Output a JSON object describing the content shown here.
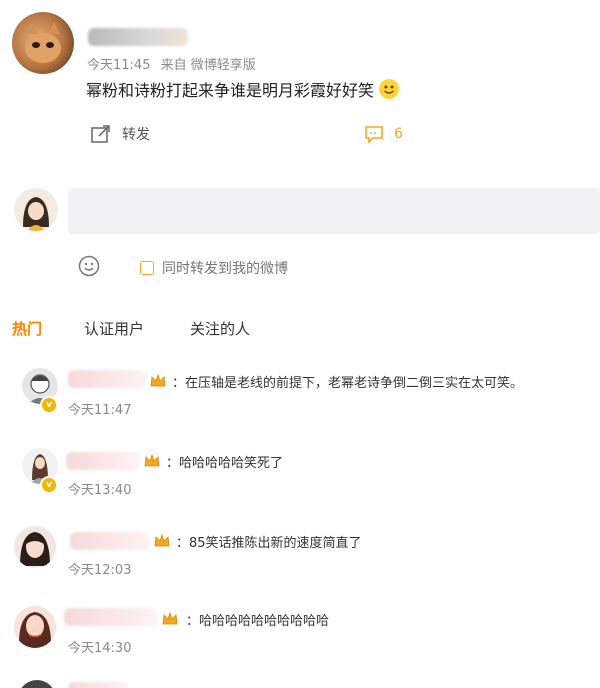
{
  "post": {
    "username_masked": "",
    "time": "今天11:45",
    "source": "来自 微博轻享版",
    "content": "幂粉和诗粉打起来争谁是明月彩霞好好笑",
    "emoji": "🙂",
    "repost_label": "转发",
    "comment_count": "6"
  },
  "composer": {
    "input_value": "",
    "sync_repost_label": "同时转发到我的微博"
  },
  "tabs": [
    {
      "label": "热门",
      "active": true
    },
    {
      "label": "认证用户",
      "active": false
    },
    {
      "label": "关注的人",
      "active": false
    }
  ],
  "comments": [
    {
      "text": "：在压轴是老线的前提下，老幂老诗争倒二倒三实在太可笑。",
      "time": "今天11:47",
      "verified": true
    },
    {
      "text": "：哈哈哈哈哈笑死了",
      "time": "今天13:40",
      "verified": true
    },
    {
      "text": "：85笑话推陈出新的速度简直了",
      "time": "今天12:03",
      "verified": false
    },
    {
      "text": "：哈哈哈哈哈哈哈哈哈哈",
      "time": "今天14:30",
      "verified": false
    }
  ],
  "colors": {
    "accent": "#ff8200",
    "active_tab": "#ff8200",
    "comment_count": "#f5a623"
  }
}
